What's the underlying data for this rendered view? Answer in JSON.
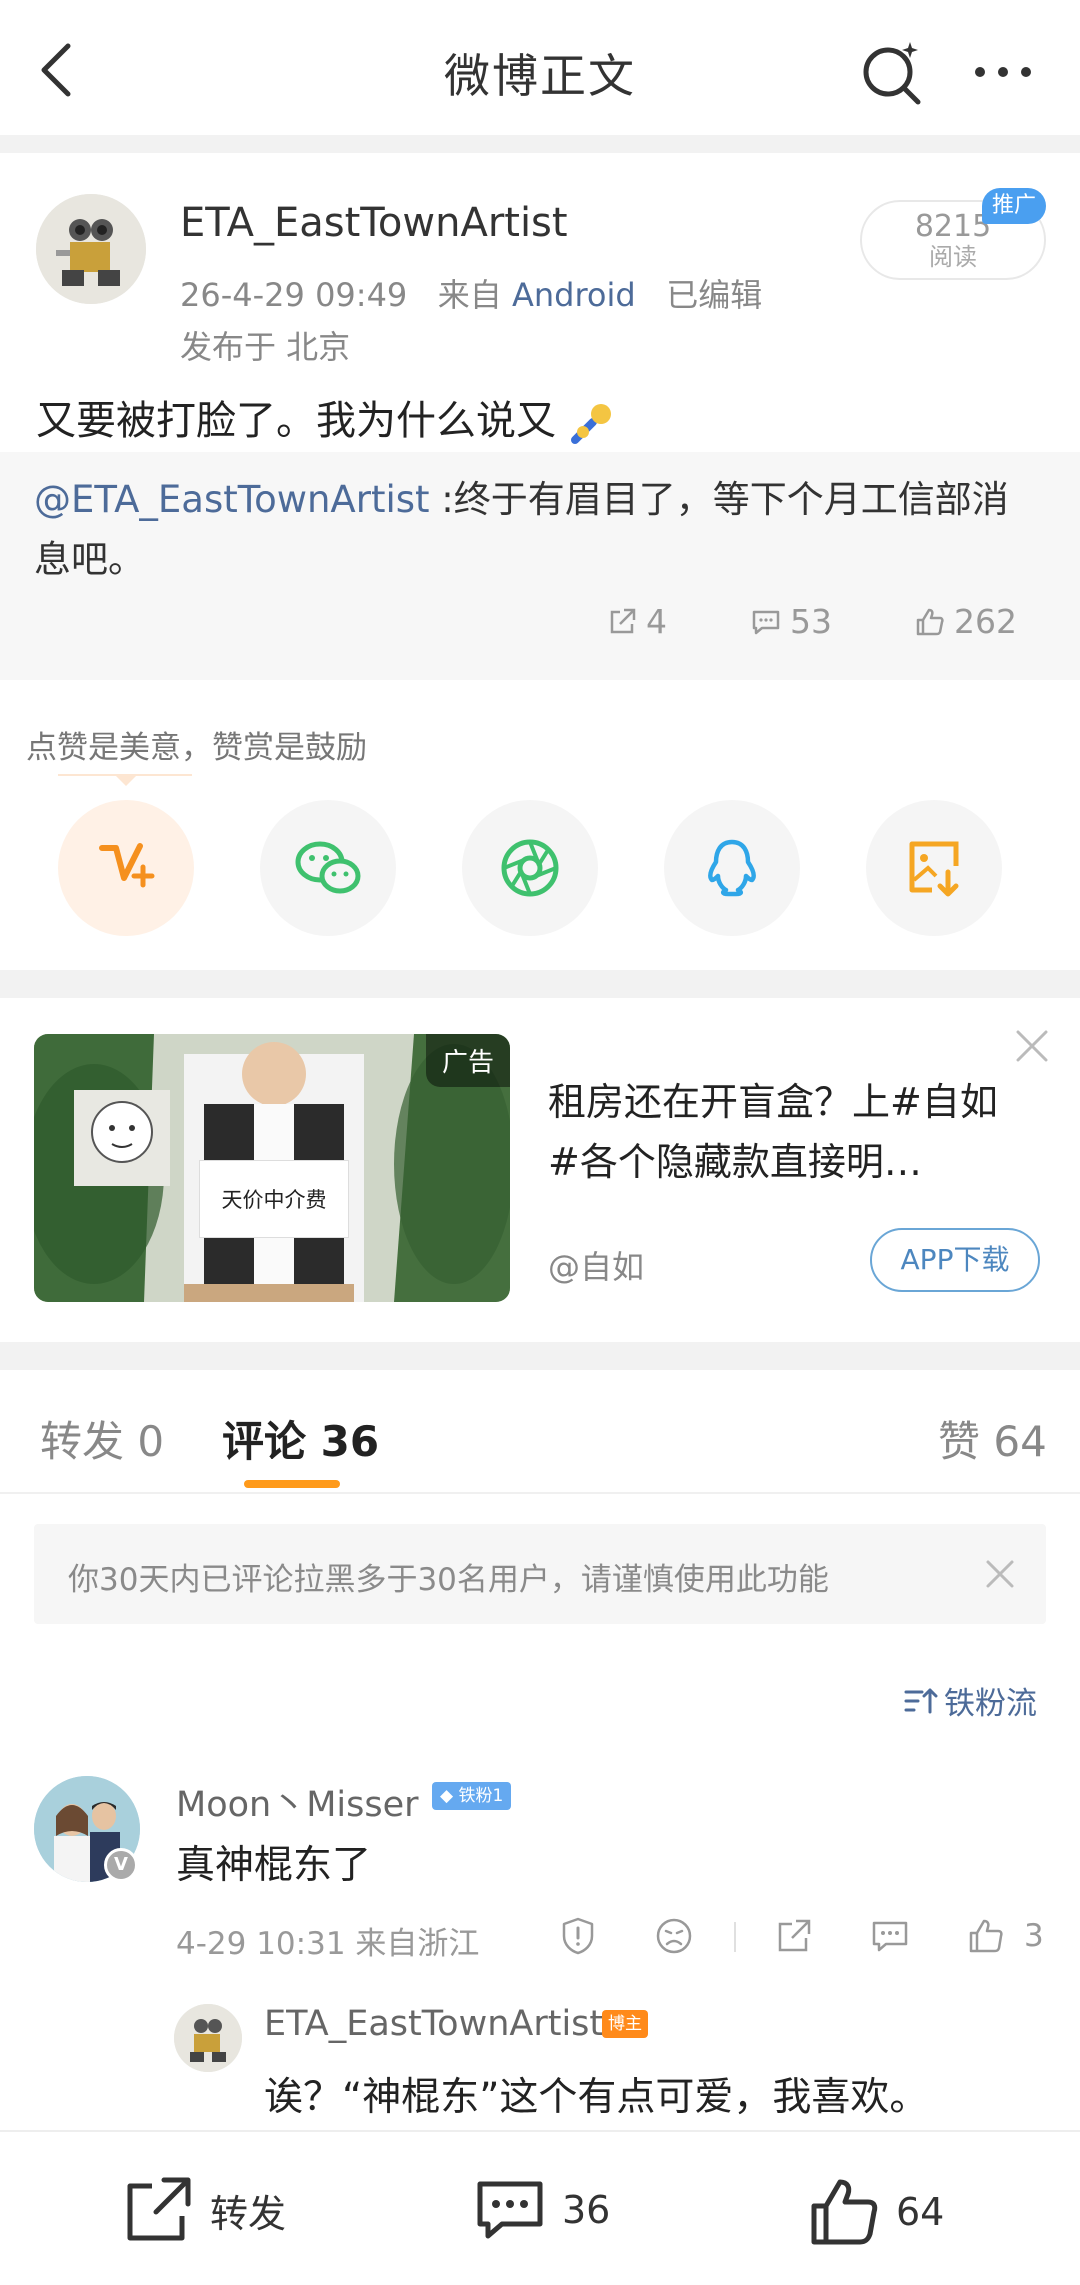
{
  "topbar": {
    "title": "微博正文"
  },
  "post": {
    "author": "ETA_EastTownArtist",
    "datetime": "26-4-29 09:49",
    "source_prefix": "来自",
    "source": "Android",
    "edited": "已编辑",
    "location": "发布于 北京",
    "read_count": "8215",
    "read_label": "阅读",
    "promo_badge": "推广",
    "text": "又要被打脸了。我为什么说又"
  },
  "repost": {
    "mention": "@ETA_EastTownArtist",
    "text": " :终于有眉目了，等下个月工信部消息吧。",
    "shares": "4",
    "comments": "53",
    "likes": "262"
  },
  "reward": {
    "text": "点赞是美意，赞赏是鼓励",
    "share_targets": [
      "v-reward-icon",
      "wechat-icon",
      "moments-icon",
      "qq-icon",
      "save-image-icon"
    ]
  },
  "ad": {
    "tag": "广告",
    "image_sign": "天价中介费",
    "title": "租房还在开盲盒？上#自如#各个隐藏款直接明…",
    "source": "@自如",
    "button": "APP下载"
  },
  "tabs": {
    "repost_label": "转发",
    "repost_count": "0",
    "comment_label": "评论",
    "comment_count": "36",
    "like_label": "赞",
    "like_count": "64"
  },
  "notice": {
    "text": "你30天内已评论拉黑多于30名用户，请谨慎使用此功能"
  },
  "sort": {
    "label": "铁粉流"
  },
  "comment": {
    "user": "Moon丶Misser",
    "fan_badge": "铁粉1",
    "text": "真神棍东了",
    "meta": "4-29 10:31 来自浙江",
    "likes": "3"
  },
  "reply": {
    "user": "ETA_EastTownArtist",
    "badge": "博主",
    "text": "诶？“神棍东”这个有点可爱，我喜欢。"
  },
  "bottombar": {
    "repost_label": "转发",
    "comment_count": "36",
    "like_count": "64"
  },
  "colors": {
    "link_blue": "#4d6b99",
    "accent_orange": "#ff9a1a",
    "promo_blue": "#4a9ff0"
  }
}
